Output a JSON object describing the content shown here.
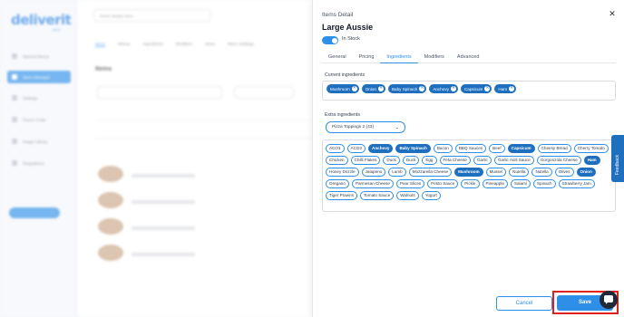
{
  "background": {
    "logo": "deliverit",
    "logo_sub": "docs",
    "store_select": "Studio Sample Store",
    "main_tabs": [
      "Items",
      "Menus",
      "Ingredients",
      "Modifiers",
      "Sizes",
      "Menu Settings"
    ],
    "items_title": "Items",
    "sidebar_items": [
      "Manual Menus",
      "Menu Manager",
      "Settings",
      "Promo Code",
      "Image Library",
      "Integrations"
    ]
  },
  "drawer": {
    "header_label": "Items Detail",
    "close_icon": "close-icon",
    "title": "Large Aussie",
    "in_stock_label": "In Stock",
    "in_stock": true,
    "tabs": [
      "General",
      "Pricing",
      "Ingredients",
      "Modifiers",
      "Advanced"
    ],
    "active_tab": "Ingredients",
    "current_label": "Current ingredients",
    "current_ingredients": [
      "Mushroom",
      "Onion",
      "Baby Spinach",
      "Anchovy",
      "Capsicum",
      "Ham"
    ],
    "extra_label": "Extra ingredients",
    "extra_select": "Pizza Toppings 2 (43)",
    "extra_ingredients": [
      {
        "label": "ACO1",
        "selected": false
      },
      {
        "label": "ACO2",
        "selected": false
      },
      {
        "label": "Anchovy",
        "selected": true
      },
      {
        "label": "Baby Spinach",
        "selected": true
      },
      {
        "label": "Bacon",
        "selected": false
      },
      {
        "label": "BBQ Sauces",
        "selected": false
      },
      {
        "label": "Beef",
        "selected": false
      },
      {
        "label": "Capsicum",
        "selected": true
      },
      {
        "label": "Cheesy Bread",
        "selected": false
      },
      {
        "label": "Cherry Tomato",
        "selected": false
      },
      {
        "label": "Chicken",
        "selected": false
      },
      {
        "label": "Chilli Flakes",
        "selected": false
      },
      {
        "label": "Duck",
        "selected": false
      },
      {
        "label": "Duck",
        "selected": false
      },
      {
        "label": "Egg",
        "selected": false
      },
      {
        "label": "Feta Cheese",
        "selected": false
      },
      {
        "label": "Garlic",
        "selected": false
      },
      {
        "label": "Garlic Aioli Sauce",
        "selected": false
      },
      {
        "label": "Gorgonzola Cheese",
        "selected": false
      },
      {
        "label": "Ham",
        "selected": true
      },
      {
        "label": "Honey Drizzle",
        "selected": false
      },
      {
        "label": "Jalapeno",
        "selected": false
      },
      {
        "label": "Lamb",
        "selected": false
      },
      {
        "label": "Mozzarella Cheese",
        "selected": false
      },
      {
        "label": "Mushroom",
        "selected": true
      },
      {
        "label": "Mussel",
        "selected": false
      },
      {
        "label": "Nutella",
        "selected": false
      },
      {
        "label": "Nutella",
        "selected": false
      },
      {
        "label": "Olives",
        "selected": false
      },
      {
        "label": "Onion",
        "selected": true
      },
      {
        "label": "Oregano",
        "selected": false
      },
      {
        "label": "Parmesan Cheese",
        "selected": false
      },
      {
        "label": "Pear Slices",
        "selected": false
      },
      {
        "label": "Pesto Sauce",
        "selected": false
      },
      {
        "label": "Pickle",
        "selected": false
      },
      {
        "label": "Pineapple",
        "selected": false
      },
      {
        "label": "Salami",
        "selected": false
      },
      {
        "label": "Spinach",
        "selected": false
      },
      {
        "label": "Strawberry Jam",
        "selected": false
      },
      {
        "label": "Tiger Prawns",
        "selected": false
      },
      {
        "label": "Tomato Sauce",
        "selected": false
      },
      {
        "label": "Walnuts",
        "selected": false
      },
      {
        "label": "Yogurt",
        "selected": false
      }
    ],
    "cancel_label": "Cancel",
    "save_label": "Save"
  },
  "feedback_label": "Feedback",
  "colors": {
    "accent": "#2e8fe8",
    "chip_selected": "#1f6fbf",
    "highlight": "#e0211f"
  }
}
